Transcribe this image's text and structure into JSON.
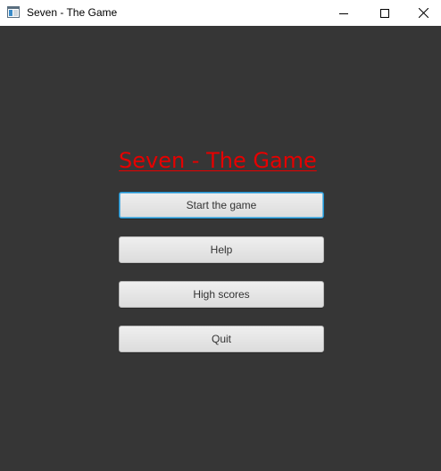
{
  "window": {
    "title": "Seven - The Game",
    "app_icon": "window-app-icon",
    "controls": {
      "minimize_icon": "minimize-icon",
      "maximize_icon": "maximize-icon",
      "close_icon": "close-icon"
    }
  },
  "main": {
    "heading": "Seven - The Game",
    "buttons": [
      {
        "label": "Start the game",
        "focused": true
      },
      {
        "label": "Help",
        "focused": false
      },
      {
        "label": "High scores",
        "focused": false
      },
      {
        "label": "Quit",
        "focused": false
      }
    ]
  },
  "colors": {
    "background": "#363636",
    "heading": "#e60000",
    "focus_ring": "#1f93d0"
  }
}
